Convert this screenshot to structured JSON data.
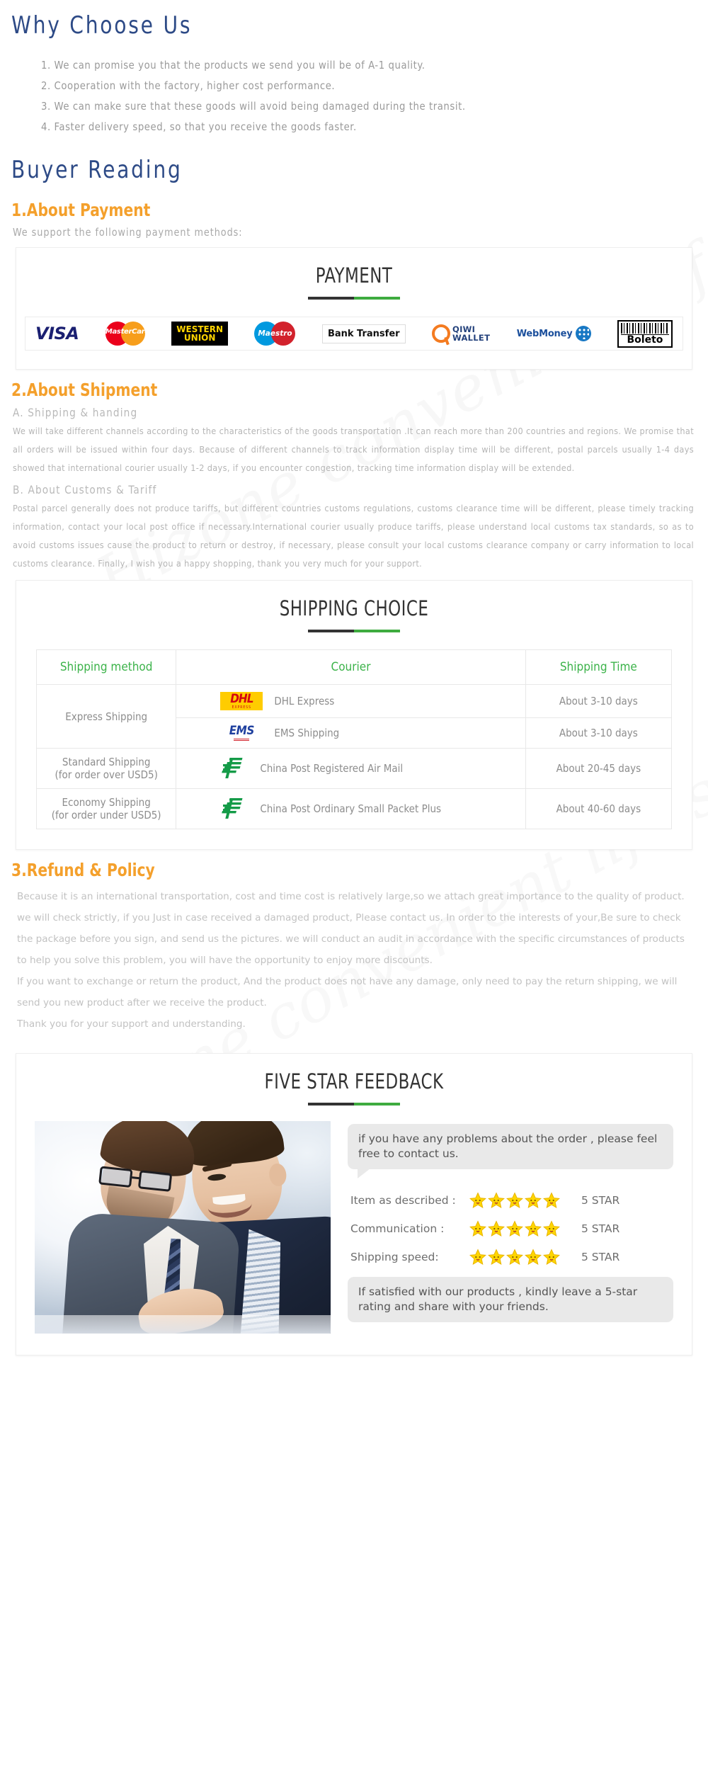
{
  "why_choose_us": {
    "title": "Why Choose Us",
    "items": [
      "1. We can promise you that the products we send you will be of A-1 quality.",
      "2. Cooperation with the factory, higher cost performance.",
      "3. We can make sure that these goods will avoid being damaged during the transit.",
      "4. Faster delivery speed, so that you receive the goods faster."
    ]
  },
  "buyer_reading": {
    "title": "Buyer  Reading"
  },
  "payment": {
    "heading": "1.About Payment",
    "subtitle": "We support the following payment methods:",
    "panel_title": "PAYMENT",
    "methods": [
      {
        "name": "visa-logo",
        "label": "VISA"
      },
      {
        "name": "mastercard-logo",
        "label": "MasterCard"
      },
      {
        "name": "western-union-logo",
        "label": "WESTERN",
        "label2": "UNION"
      },
      {
        "name": "maestro-logo",
        "label": "Maestro"
      },
      {
        "name": "bank-transfer-logo",
        "label": "Bank Transfer"
      },
      {
        "name": "qiwi-wallet-logo",
        "label": "QIWI",
        "label2": "WALLET"
      },
      {
        "name": "webmoney-logo",
        "label": "WebMoney"
      },
      {
        "name": "boleto-logo",
        "label": "Boleto"
      }
    ]
  },
  "shipment": {
    "heading": "2.About Shipment",
    "sub_a": "A. Shipping & handing",
    "para_a": "We will take different channels according to the characteristics of the goods transportation .It can reach more than 200 countries and regions. We promise that all orders will be issued within four days. Because of different channels to track information display time will be different, postal parcels usually 1-4 days showed that international courier usually 1-2 days, if you encounter congestion, tracking time information display will be extended.",
    "sub_b": "B. About Customs & Tariff",
    "para_b": "Postal parcel generally does not produce tariffs, but different countries customs regulations, customs clearance time will be different, please timely tracking information, contact your local post office if necessary.International courier usually produce tariffs, please understand local customs tax standards, so as to avoid customs issues cause the product to return or destroy, if necessary, please consult your local customs clearance company or carry information to local customs clearance. Finally, I wish you a happy shopping, thank you very much for your support."
  },
  "shipping_choice": {
    "panel_title": "SHIPPING CHOICE",
    "headers": [
      "Shipping method",
      "Courier",
      "Shipping Time"
    ],
    "rows": [
      {
        "method": "Express Shipping",
        "method_sub": "",
        "rowspan": 2,
        "couriers": [
          {
            "logo": "dhl-logo",
            "logo_text": "DHL",
            "logo_sub": "EXPRESS",
            "name": "DHL Express",
            "time": "About 3-10 days"
          },
          {
            "logo": "ems-logo",
            "logo_text": "EMS",
            "logo_sub": "",
            "name": "EMS Shipping",
            "time": "About 3-10 days"
          }
        ]
      },
      {
        "method": "Standard Shipping",
        "method_sub": "(for order over USD5)",
        "rowspan": 1,
        "couriers": [
          {
            "logo": "china-post-logo",
            "logo_text": "",
            "logo_sub": "",
            "name": "China Post Registered Air Mail",
            "time": "About 20-45 days"
          }
        ]
      },
      {
        "method": "Economy Shipping",
        "method_sub": "(for order under USD5)",
        "rowspan": 1,
        "couriers": [
          {
            "logo": "china-post-logo",
            "logo_text": "",
            "logo_sub": "",
            "name": "China Post Ordinary Small Packet Plus",
            "time": "About 40-60 days"
          }
        ]
      }
    ]
  },
  "refund": {
    "heading": "3.Refund & Policy",
    "paragraphs": [
      "Because it is an international transportation, cost and time cost is relatively large,so we attach great importance to the quality of product. we will check strictly, if you Just in case received a damaged product, Please contact us. In order to the interests of your,Be sure to check the package before you sign, and send us the pictures. we will conduct an audit in accordance with the specific circumstances of products to help you solve this problem, you will have the opportunity to enjoy more discounts.",
      "If you want to exchange or return the product, And the product does not have any damage, only need to pay the return shipping, we will send you new product after we receive the product.",
      "Thank you for your support and understanding."
    ]
  },
  "feedback": {
    "panel_title": "FIVE STAR FEEDBACK",
    "photo_alt": "two-businessmen-photo",
    "bubble_top": "if you have any problems about the order , please feel free to contact us.",
    "ratings": [
      {
        "label": "Item as described :",
        "stars": 5,
        "value": "5 STAR"
      },
      {
        "label": "Communication :",
        "stars": 5,
        "value": "5 STAR"
      },
      {
        "label": "Shipping speed:",
        "stars": 5,
        "value": "5 STAR"
      }
    ],
    "bubble_bottom": "If satisfied with our products , kindly leave a 5-star rating and share with your friends."
  },
  "watermark": {
    "text": "Hizone convenient life store"
  },
  "colors": {
    "navy": "#2d4a86",
    "orange": "#f4a02c",
    "green": "#3cb34a",
    "dark_rule": "#333333",
    "grey_text": "#b5b5b5"
  }
}
